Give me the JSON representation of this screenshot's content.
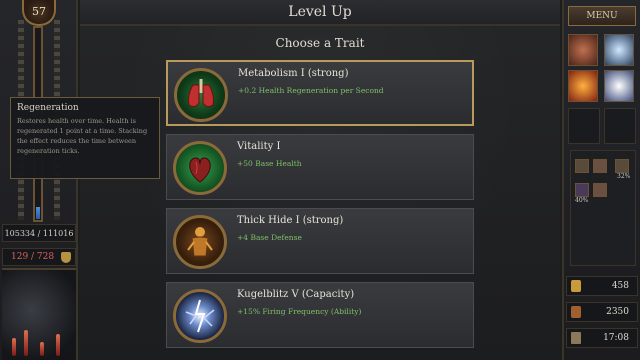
{
  "header": {
    "title": "Level Up",
    "subtitle": "Choose a Trait"
  },
  "player": {
    "level": "57",
    "xp_text": "105334 / 111016",
    "xp_progress": 0.06,
    "health_text": "129 / 728"
  },
  "tooltip": {
    "title": "Regeneration",
    "body": "Restores health over time. Health is regenerated 1 point at a time. Stacking the effect reduces the time between regeneration ticks."
  },
  "traits": [
    {
      "name": "Metabolism I (strong)",
      "desc": "+0.2 Health Regeneration per Second",
      "icon": "lungs-icon",
      "selected": true
    },
    {
      "name": "Vitality I",
      "desc": "+50 Base Health",
      "icon": "heart-icon",
      "selected": false
    },
    {
      "name": "Thick Hide I (strong)",
      "desc": "+4 Base Defense",
      "icon": "armored-figure-icon",
      "selected": false
    },
    {
      "name": "Kugelblitz V (Capacity)",
      "desc": "+15% Firing Frequency (Ability)",
      "icon": "lightning-orb-icon",
      "selected": false
    }
  ],
  "menu": {
    "label": "MENU"
  },
  "party": {
    "pct1": "32%",
    "pct2": "40%"
  },
  "resources": {
    "gold": "458",
    "wood": "2350",
    "time": "17:08"
  },
  "colors": {
    "accent": "#b89a5c",
    "desc_green": "#7fbf6a",
    "health_red": "#d86060",
    "xp_blue": "#3a78c8"
  }
}
